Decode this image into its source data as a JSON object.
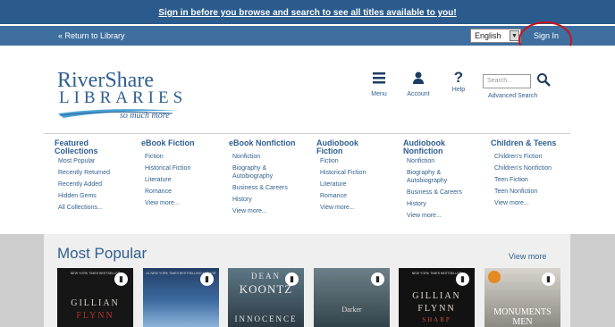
{
  "top_banner": {
    "text": "Sign in before you browse and search to see all titles available to you!"
  },
  "nav": {
    "return_label": "« Return to Library",
    "language": "English",
    "language_arrow": "▼",
    "signin_label": "Sign In"
  },
  "logo": {
    "line1": "RiverShare",
    "line2": "LIBRARIES",
    "tagline": "so much more"
  },
  "header_icons": {
    "menu": "Menu",
    "account": "Account",
    "help": "Help"
  },
  "search": {
    "placeholder": "Search...",
    "advanced": "Advanced Search"
  },
  "categories": [
    {
      "heading": "Featured Collections",
      "items": [
        "Most Popular",
        "Recently Returned",
        "Recently Added",
        "Hidden Gems",
        "All Collections..."
      ]
    },
    {
      "heading": "eBook Fiction",
      "items": [
        "Fiction",
        "Historical Fiction",
        "Literature",
        "Romance",
        "View more..."
      ]
    },
    {
      "heading": "eBook Nonfiction",
      "items": [
        "Nonfiction",
        "Biography & Autobiography",
        "Business & Careers",
        "History",
        "View more..."
      ]
    },
    {
      "heading": "Audiobook Fiction",
      "items": [
        "Fiction",
        "Historical Fiction",
        "Literature",
        "Romance",
        "View more..."
      ]
    },
    {
      "heading": "Audiobook Nonfiction",
      "items": [
        "Nonfiction",
        "Biography & Autobiography",
        "Business & Careers",
        "History",
        "View more..."
      ]
    },
    {
      "heading": "Children & Teens",
      "items": [
        "Children's Fiction",
        "Children's Nonfiction",
        "Teen Fiction",
        "Teen Nonfiction",
        "View more..."
      ]
    }
  ],
  "popular": {
    "title": "Most Popular",
    "view_more": "View more",
    "books": [
      {
        "top": "NEW YORK TIMES BESTSELLER",
        "line1": "GILLIAN",
        "line2": "FLYNN",
        "line3": ""
      },
      {
        "top": "#1 NEW YORK TIMES BESTSELLING AUTHOR",
        "line1": "",
        "line2": "",
        "line3": ""
      },
      {
        "top": "",
        "line1": "DEAN",
        "line2": "KOONTZ",
        "line3": "INNOCENCE"
      },
      {
        "top": "",
        "line1": "",
        "line2": "Darker",
        "line3": ""
      },
      {
        "top": "NEW YORK TIMES BESTSELLER",
        "line1": "GILLIAN",
        "line2": "FLYNN",
        "line3": "SHARP"
      },
      {
        "top": "",
        "line1": "MONUMENTS",
        "line2": "MEN",
        "line3": ""
      }
    ]
  },
  "colors": {
    "brand_blue": "#2f5f90",
    "banner": "#2a5b8c",
    "annotation_circle": "#c8141d"
  }
}
